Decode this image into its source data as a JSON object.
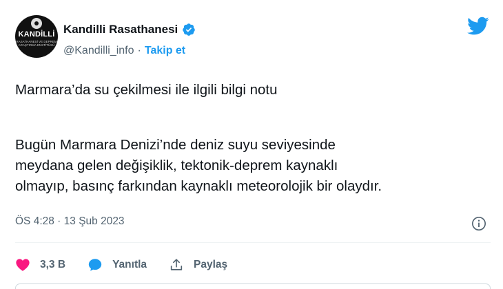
{
  "author": {
    "name": "Kandilli Rasathanesi",
    "handle": "@Kandilli_info",
    "separator": "·",
    "follow_label": "Takip et",
    "avatar": {
      "title": "KANDİLLİ",
      "subtitle": "RASATHANESİ VE DEPREM ARAŞTIRMA ENSTİTÜSÜ"
    }
  },
  "tweet": {
    "title": "Marmara’da su çekilmesi ile ilgili bilgi notu",
    "lines": [
      "Bugün Marmara Denizi’nde deniz suyu seviyesinde",
      "meydana gelen değişiklik, tektonik-deprem kaynaklı",
      "olmayıp, basınç  farkından kaynaklı meteorolojik bir olaydır."
    ],
    "timestamp": "ÖS 4:28 · 13 Şub 2023"
  },
  "actions": {
    "likes": "3,3 B",
    "reply_label": "Yanıtla",
    "share_label": "Paylaş"
  },
  "icons": {
    "verified": "verified-badge-icon",
    "logo": "twitter-bird-icon",
    "info": "info-icon",
    "like": "heart-icon",
    "reply": "comment-bubble-icon",
    "share": "share-upload-icon"
  },
  "colors": {
    "accent": "#1d9bf0",
    "like": "#f91880",
    "text": "#0f1419",
    "secondary": "#536471"
  }
}
